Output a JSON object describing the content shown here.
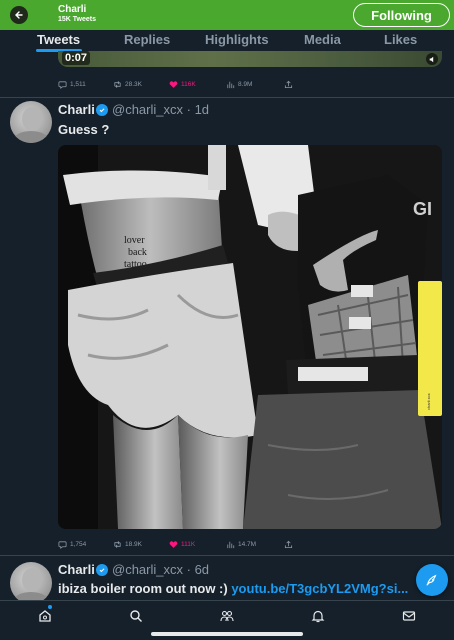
{
  "header": {
    "name": "Charli",
    "subtitle": "15K Tweets",
    "follow_label": "Following"
  },
  "tabs": [
    {
      "label": "Tweets",
      "active": true
    },
    {
      "label": "Replies",
      "active": false
    },
    {
      "label": "Highlights",
      "active": false
    },
    {
      "label": "Media",
      "active": false
    },
    {
      "label": "Likes",
      "active": false
    }
  ],
  "video": {
    "time": "0:07"
  },
  "tweet_prev": {
    "replies": "1,511",
    "retweets": "28.3K",
    "likes": "116K",
    "views": "8.9M"
  },
  "tweet1": {
    "name": "Charli",
    "handle": "@charli_xcx",
    "time": "1d",
    "text": "Guess ?",
    "tattoo": "lover\nback\ntattoo",
    "replies": "1,754",
    "retweets": "18.9K",
    "likes": "111K",
    "views": "14.7M"
  },
  "tweet2": {
    "name": "Charli",
    "handle": "@charli_xcx",
    "time": "6d",
    "text": "ibiza boiler room out now :) ",
    "link": "youtu.be/T3gcbYL2VMg?si..."
  },
  "colors": {
    "header_bg": "#4aa82f",
    "background": "#15202b",
    "accent": "#1d9bf0",
    "like": "#f91880",
    "muted": "#8b98a5"
  },
  "icons": {
    "nav": [
      "home-icon",
      "search-icon",
      "communities-icon",
      "notifications-icon",
      "messages-icon"
    ],
    "fab": "compose-icon"
  }
}
